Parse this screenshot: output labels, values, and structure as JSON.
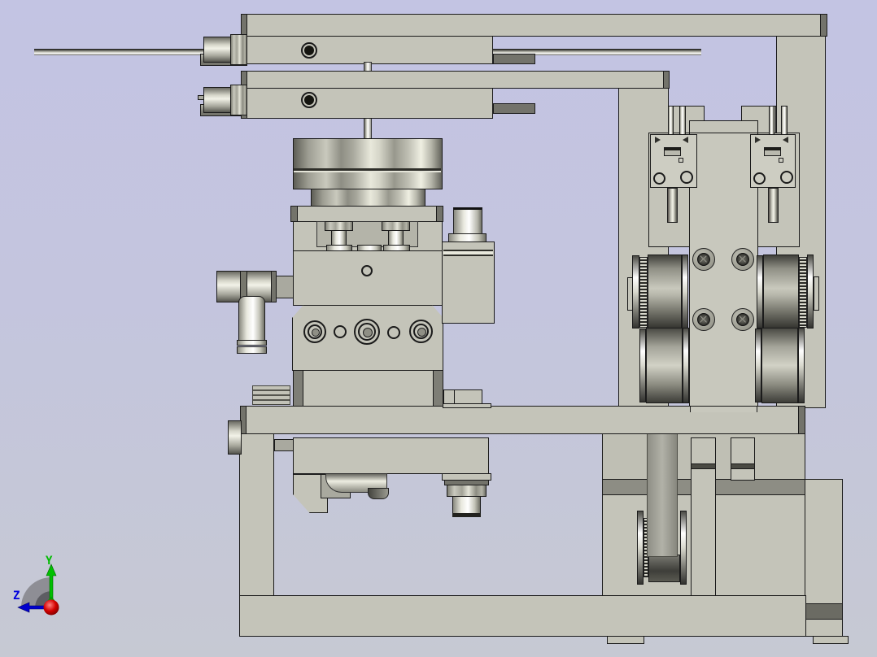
{
  "app": {
    "type": "cad-3d-viewport",
    "content": "mechanical-assembly-front-view"
  },
  "axis_triad": {
    "y_label": "Y",
    "z_label": "Z"
  },
  "colors": {
    "bg_top": "#c3c4e3",
    "bg_bottom": "#c6c9d3",
    "part": "#c4c4b9",
    "part_light": "#cdcdc2",
    "mid": "#a9a99f",
    "strip": "#73736b",
    "dark": "#4a4a43",
    "band": "#8d8d84",
    "band2": "#6b6b63",
    "ol": "#1b1b1b",
    "axis_y": "#00c000",
    "axis_z": "#0000cc",
    "origin": "#d40000"
  },
  "parts": [
    "guide-rod",
    "upper-linear-slide",
    "lower-linear-slide",
    "push-in-fitting",
    "vertical-shaft",
    "rotary-drum",
    "tooling-block",
    "elbow-fitting",
    "gripper-unit",
    "sensor-bracket",
    "timing-pulley",
    "guide-roller",
    "drive-belt",
    "lower-pulley",
    "frame-beam",
    "frame-left-leg",
    "frame-base-rail",
    "base-box",
    "support-column",
    "m12-connector",
    "axis-triad"
  ]
}
